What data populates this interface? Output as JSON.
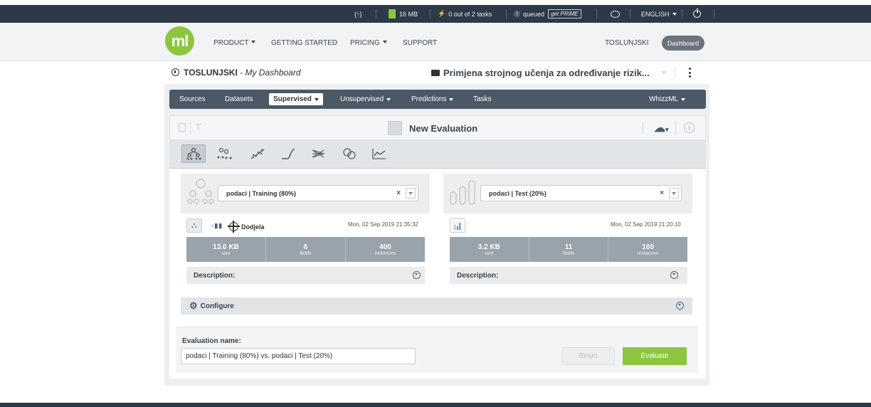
{
  "statusbar": {
    "api_icon": "{↑}",
    "license_label": "16 MB",
    "tasks_label": "0 out of 2 tasks",
    "queued_label": "queued",
    "prime_label": "get PRIME",
    "language_label": "ENGLISH"
  },
  "header": {
    "logo_text": "ml",
    "nav": {
      "product": "PRODUCT",
      "getting_started": "GETTING STARTED",
      "pricing": "PRICING",
      "support": "SUPPORT"
    },
    "username": "TOSLUNJSKI",
    "dashboard_label": "Dashboard"
  },
  "breadcrumb": {
    "user": "TOSLUNJSKI",
    "separator": " - ",
    "dashboard": "My Dashboard",
    "project": "Primjena strojnog učenja za određivanje rizik..."
  },
  "tabs": {
    "sources": "Sources",
    "datasets": "Datasets",
    "supervised": "Supervised",
    "unsupervised": "Unsupervised",
    "predictions": "Predictions",
    "tasks": "Tasks",
    "whizzml": "WhizzML"
  },
  "toolbar": {
    "title": "New Evaluation"
  },
  "training": {
    "select_value": "podaci | Training (80%)",
    "target_field": "Dodjela",
    "date": "Mon, 02 Sep 2019 21:35:32",
    "size_value": "13.0 KB",
    "size_label": "size",
    "fields_value": "6",
    "fields_label": "fields",
    "instances_value": "400",
    "instances_label": "instances",
    "description_label": "Description:"
  },
  "test": {
    "select_value": "podaci | Test (20%)",
    "date": "Mon, 02 Sep 2019 21:20:10",
    "size_value": "3.2 KB",
    "size_label": "size",
    "fields_value": "11",
    "fields_label": "fields",
    "instances_value": "100",
    "instances_label": "instances",
    "description_label": "Description:"
  },
  "configure": {
    "label": "Configure"
  },
  "evaluation": {
    "name_label": "Evaluation name:",
    "name_value": "podaci | Training (80%) vs. podaci | Test (20%)",
    "reset_label": "Reset",
    "evaluate_label": "Evaluate"
  },
  "colors": {
    "brand_green": "#8cc63f",
    "dark_nav": "#2c3a47",
    "tab_bar": "#4a5965",
    "stats_bg": "#99a3ab"
  }
}
